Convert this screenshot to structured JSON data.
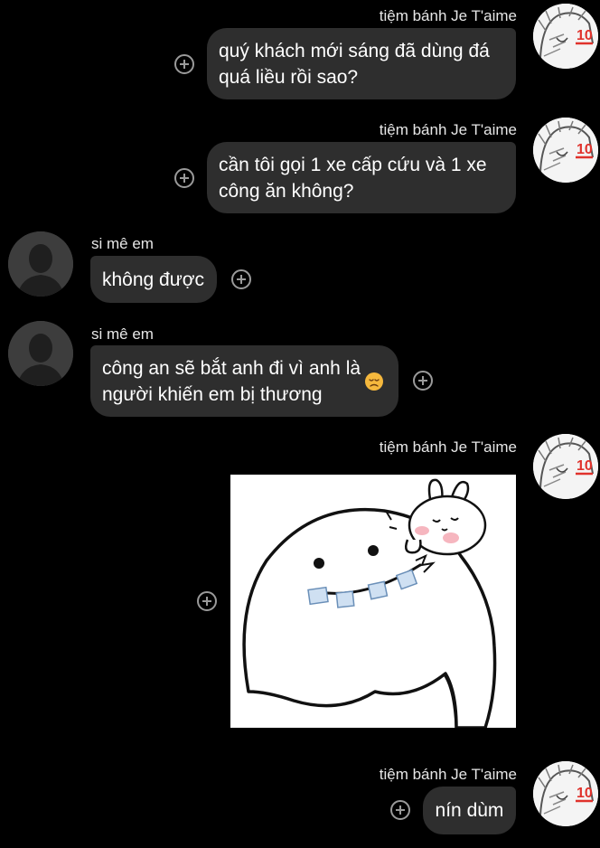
{
  "messages": [
    {
      "sender": "tiệm bánh Je T'aime",
      "text": "quý khách mới sáng đã dùng đá\nquá liều rồi sao?"
    },
    {
      "sender": "tiệm bánh Je T'aime",
      "text": "cần tôi gọi 1 xe cấp cứu và 1 xe\ncông ăn không?"
    },
    {
      "sender": "si mê em",
      "text": "không được"
    },
    {
      "sender": "si mê em",
      "text": "công an sẽ bắt anh đi vì anh là\nngười khiến em bị thương"
    },
    {
      "sender": "tiệm bánh Je T'aime",
      "sticker": "white blob character with bunny sticker"
    },
    {
      "sender": "tiệm bánh Je T'aime",
      "text": "nín dùm"
    }
  ],
  "avatar_me": {
    "badge": "10"
  },
  "emoji": "disappointed-face",
  "colors": {
    "background": "#000000",
    "bubble": "#2e2e2e",
    "badge": "#e0322c"
  }
}
